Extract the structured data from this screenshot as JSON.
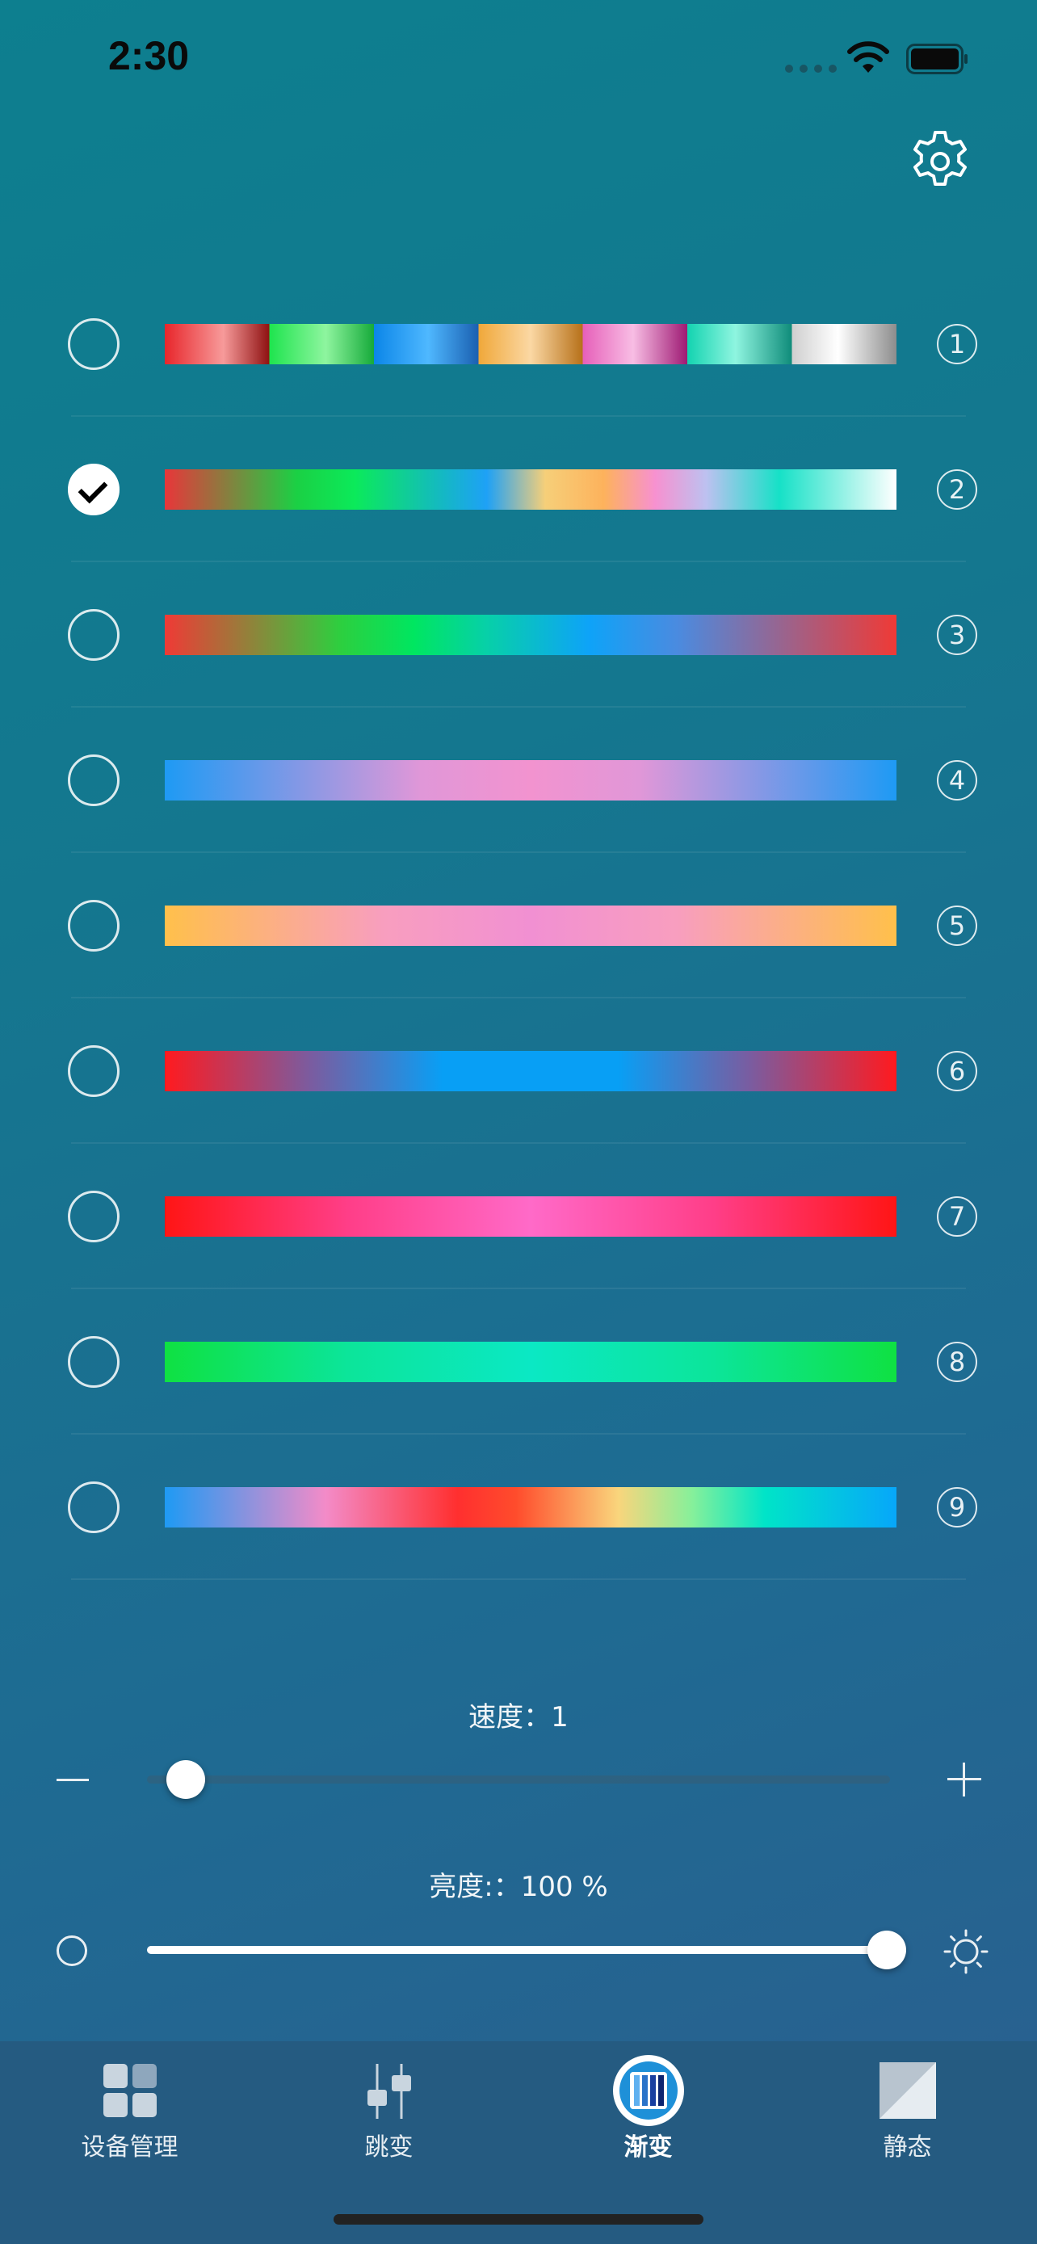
{
  "status_bar": {
    "time": "2:30"
  },
  "header": {
    "settings_icon": "gear-icon"
  },
  "gradients": [
    {
      "number": "1",
      "selected": false,
      "css": "linear-gradient(90deg,#e8262b 0%,#f79a9a 8%,#8e1111 14.3%,#1ee44e 14.3%,#8ef59f 22%,#16aa3a 28.6%,#0b86e8 28.6%,#4fb8ff 36%,#1a5fb0 42.9%,#f0a83a 42.9%,#fbd8a4 50%,#b7711a 57.1%,#e65fb9 57.1%,#f8bde4 64%,#9e1a73 71.4%,#12d3b0 71.4%,#8ff5e0 78%,#0f8c7a 85.7%,#cfcfcf 85.7%,#ffffff 92%,#8d8d8d 100%)"
    },
    {
      "number": "2",
      "selected": true,
      "css": "linear-gradient(90deg,#e8363a 0%,#1bd044 18%,#0bea5a 26%,#14b8c4 38%,#1ea1f6 44%,#f6cf79 52%,#fdb25c 60%,#f791d0 67%,#bdc1f0 74%,#16e1c7 84%,#ffffff 100%)"
    },
    {
      "number": "3",
      "selected": false,
      "css": "linear-gradient(90deg,#ef3a36 0%,#2dcf3f 24%,#00e660 34%,#07d0a8 44%,#0ea3f8 58%,#4a8be0 70%,#ef3a36 100%)"
    },
    {
      "number": "4",
      "selected": false,
      "css": "linear-gradient(90deg,#1e9af4 0%,#e097d8 35%,#f293cf 50%,#e097d8 65%,#1e9af4 100%)"
    },
    {
      "number": "5",
      "selected": false,
      "css": "linear-gradient(90deg,#ffc04b 0%,#f89ebf 30%,#f190d2 50%,#f89ebf 70%,#ffc04b 100%)"
    },
    {
      "number": "6",
      "selected": false,
      "css": "linear-gradient(90deg,#ff1a1f 0%,#7a5ca0 20%,#089ff5 38%,#089ff5 62%,#7a5ca0 80%,#ff1a1f 100%)"
    },
    {
      "number": "7",
      "selected": false,
      "css": "linear-gradient(90deg,#ff1515 0%,#ff3e88 25%,#ff6ac8 50%,#ff3e88 75%,#ff1515 100%)"
    },
    {
      "number": "8",
      "selected": false,
      "css": "linear-gradient(90deg,#0fe142 0%,#0ce59a 25%,#0be8c4 50%,#0ce59a 75%,#0fe142 100%)"
    },
    {
      "number": "9",
      "selected": false,
      "css": "linear-gradient(90deg,#1e9af4 0%,#f38bc8 22%,#ff2f2f 40%,#ff4c2c 48%,#f9d57c 62%,#87f09a 72%,#00e4c8 82%,#07a7fa 100%)"
    }
  ],
  "speed": {
    "label": "速度：1",
    "value": 1,
    "fraction": 0.02
  },
  "brightness": {
    "label": "亮度:：100 %",
    "value": 100,
    "fraction": 1.0
  },
  "tabs": [
    {
      "label": "设备管理",
      "icon": "device-grid-icon",
      "active": false
    },
    {
      "label": "跳变",
      "icon": "jump-slider-icon",
      "active": false
    },
    {
      "label": "渐变",
      "icon": "gradient-icon",
      "active": true
    },
    {
      "label": "静态",
      "icon": "static-icon",
      "active": false
    }
  ],
  "colors": {
    "accent": "#ffffff",
    "tabbar": "#255b81"
  }
}
